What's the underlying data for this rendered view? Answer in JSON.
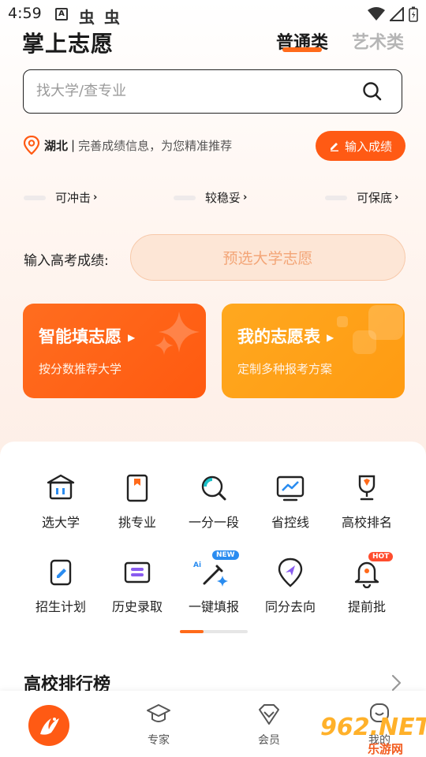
{
  "status_bar": {
    "time": "4:59",
    "bug_glyph": "虫"
  },
  "header": {
    "logo": "掌上志愿",
    "tabs": [
      "普通类",
      "艺术类"
    ]
  },
  "search": {
    "placeholder": "找大学/查专业"
  },
  "location": {
    "region": "湖北",
    "separator": "|",
    "hint": "完善成绩信息，为您精准推荐",
    "button": "输入成绩"
  },
  "categories": [
    {
      "label": "可冲击",
      "arrow": "›"
    },
    {
      "label": "较稳妥",
      "arrow": "›"
    },
    {
      "label": "可保底",
      "arrow": "›"
    }
  ],
  "score_entry": {
    "label": "输入高考成绩:",
    "button": "预选大学志愿"
  },
  "cards": [
    {
      "title": "智能填志愿",
      "subtitle": "按分数推荐大学",
      "color": "#ff6a1a"
    },
    {
      "title": "我的志愿表",
      "subtitle": "定制多种报考方案",
      "color": "#ffa41b"
    }
  ],
  "grid": [
    {
      "label": "选大学",
      "icon": "university-icon"
    },
    {
      "label": "挑专业",
      "icon": "book-icon"
    },
    {
      "label": "一分一段",
      "icon": "magnifier-icon"
    },
    {
      "label": "省控线",
      "icon": "trend-chart-icon"
    },
    {
      "label": "高校排名",
      "icon": "trophy-icon"
    },
    {
      "label": "招生计划",
      "icon": "edit-document-icon"
    },
    {
      "label": "历史录取",
      "icon": "list-card-icon"
    },
    {
      "label": "一键填报",
      "icon": "ai-wand-icon",
      "badge": "NEW",
      "ai": "Ai"
    },
    {
      "label": "同分去向",
      "icon": "location-arrow-icon"
    },
    {
      "label": "提前批",
      "icon": "bell-icon",
      "badge": "HOT"
    }
  ],
  "ranking": {
    "title": "高校排行榜"
  },
  "bottom_nav": [
    {
      "label": "",
      "icon": "app-logo-icon"
    },
    {
      "label": "专家",
      "icon": "graduation-cap-icon"
    },
    {
      "label": "会员",
      "icon": "diamond-icon"
    },
    {
      "label": "我的",
      "icon": "profile-icon"
    }
  ],
  "watermark": {
    "brand": "962.NET",
    "sub": "乐游网"
  },
  "colors": {
    "accent": "#ff5a14",
    "accent_light": "#fde6d6",
    "card_orange": "#ff6a1a",
    "card_amber": "#ffa41b"
  }
}
